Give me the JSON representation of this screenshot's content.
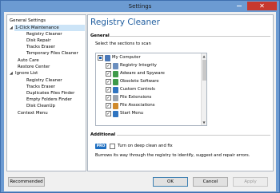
{
  "window": {
    "title": "Settings",
    "close_glyph": "✕"
  },
  "sidebar": {
    "items": [
      {
        "label": "General Settings"
      },
      {
        "label": "1-Click Maintenance",
        "caret": "◢"
      },
      {
        "label": "Registry Cleaner"
      },
      {
        "label": "Disk Repair"
      },
      {
        "label": "Tracks Eraser"
      },
      {
        "label": "Temporary Files Cleaner"
      },
      {
        "label": "Auto Care"
      },
      {
        "label": "Restore Center"
      },
      {
        "label": "Ignore List",
        "caret": "◢"
      },
      {
        "label": "Registry Cleaner"
      },
      {
        "label": "Tracks Eraser"
      },
      {
        "label": "Duplicates Files Finder"
      },
      {
        "label": "Empty Folders Finder"
      },
      {
        "label": "Disk CleanUp"
      },
      {
        "label": "Context Menu"
      }
    ]
  },
  "main": {
    "title": "Registry Cleaner",
    "general": {
      "heading": "General",
      "hint": "Select the sections to scan",
      "items": [
        {
          "label": "My Computer",
          "check": "",
          "icon_color": "#4a78b8"
        },
        {
          "label": "Registry Integrity",
          "check": "✓",
          "icon_color": "#6b8fbf"
        },
        {
          "label": "Adware and Spyware",
          "check": "✓",
          "icon_color": "#3f9a4a"
        },
        {
          "label": "Obsolete Software",
          "check": "✓",
          "icon_color": "#3f9a4a"
        },
        {
          "label": "Custom Controls",
          "check": "✓",
          "icon_color": "#2f74c0"
        },
        {
          "label": "File Extensions",
          "check": "✓",
          "icon_color": "#9aa4b0"
        },
        {
          "label": "File Associations",
          "check": "✓",
          "icon_color": "#d08a2c"
        },
        {
          "label": "Start Menu",
          "check": "✓",
          "icon_color": "#2f74c0"
        }
      ],
      "scroll_up": "▲",
      "scroll_down": "▼"
    },
    "additional": {
      "heading": "Additional",
      "pro_badge": "PRO",
      "deep_clean_label": "Turn on deep clean and fix",
      "description": "Burrows its way through the registry to identify, suggest and repair errors."
    }
  },
  "footer": {
    "recommended": "Recommended",
    "ok": "OK",
    "cancel": "Cancel",
    "apply": "Apply"
  },
  "colors": {
    "accent": "#1e5c9e",
    "selection": "#cce4f7",
    "pro": "#1f6fc1"
  }
}
